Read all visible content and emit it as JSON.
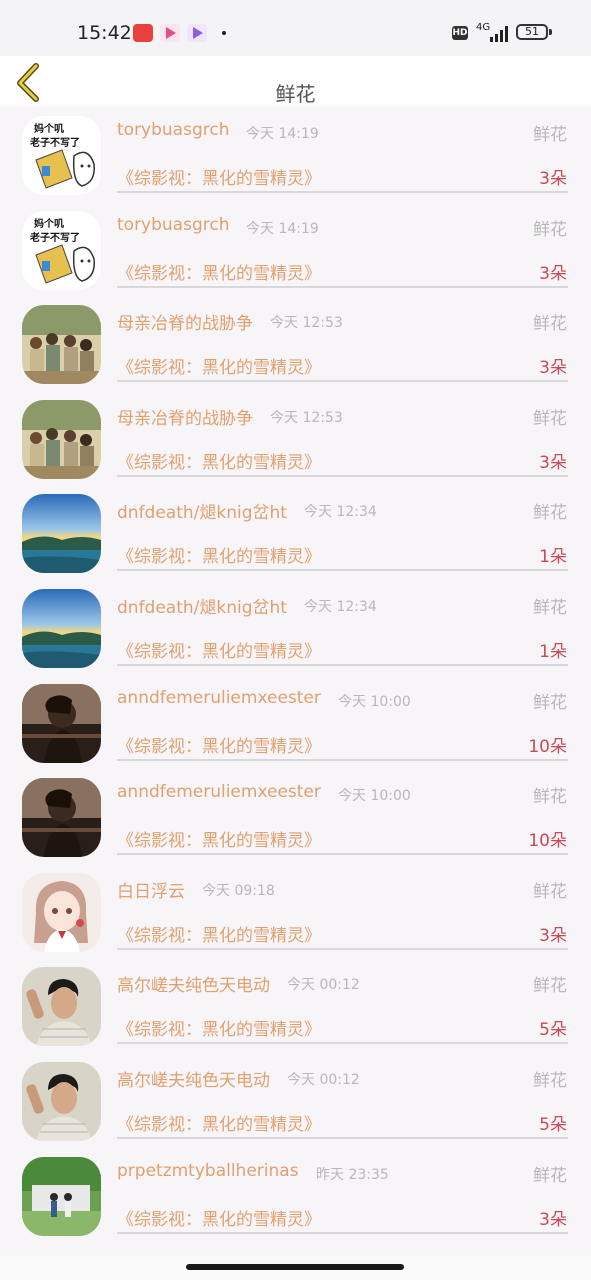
{
  "status_bar": {
    "time": "15:42",
    "network": "4G",
    "battery": "51"
  },
  "header": {
    "title": "鲜花"
  },
  "items": [
    {
      "name": "torybuasgrch",
      "time": "今天 14:19",
      "kind": "鲜花",
      "book": "《综影视：黑化的雪精灵》",
      "count": "3朵",
      "avatar": "meme-avatar"
    },
    {
      "name": "torybuasgrch",
      "time": "今天 14:19",
      "kind": "鲜花",
      "book": "《综影视：黑化的雪精灵》",
      "count": "3朵",
      "avatar": "meme-avatar"
    },
    {
      "name": "母亲冶脊的战胁争",
      "time": "今天 12:53",
      "kind": "鲜花",
      "book": "《综影视：黑化的雪精灵》",
      "count": "3朵",
      "avatar": "group-photo-avatar"
    },
    {
      "name": "母亲冶脊的战胁争",
      "time": "今天 12:53",
      "kind": "鲜花",
      "book": "《综影视：黑化的雪精灵》",
      "count": "3朵",
      "avatar": "group-photo-avatar"
    },
    {
      "name": "dnfdeath/煺knig岔ht",
      "time": "今天 12:34",
      "kind": "鲜花",
      "book": "《综影视：黑化的雪精灵》",
      "count": "1朵",
      "avatar": "landscape-avatar"
    },
    {
      "name": "dnfdeath/煺knig岔ht",
      "time": "今天 12:34",
      "kind": "鲜花",
      "book": "《综影视：黑化的雪精灵》",
      "count": "1朵",
      "avatar": "landscape-avatar"
    },
    {
      "name": "anndfemeruliemxeester",
      "time": "今天 10:00",
      "kind": "鲜花",
      "book": "《综影视：黑化的雪精灵》",
      "count": "10朵",
      "avatar": "silhouette-avatar"
    },
    {
      "name": "anndfemeruliemxeester",
      "time": "今天 10:00",
      "kind": "鲜花",
      "book": "《综影视：黑化的雪精灵》",
      "count": "10朵",
      "avatar": "silhouette-avatar"
    },
    {
      "name": "白日浮云",
      "time": "今天 09:18",
      "kind": "鲜花",
      "book": "《综影视：黑化的雪精灵》",
      "count": "3朵",
      "avatar": "anime-girl-avatar"
    },
    {
      "name": "高尔嵯夫纯色天电动",
      "time": "今天 00:12",
      "kind": "鲜花",
      "book": "《综影视：黑化的雪精灵》",
      "count": "5朵",
      "avatar": "portrait-avatar"
    },
    {
      "name": "高尔嵯夫纯色天电动",
      "time": "今天 00:12",
      "kind": "鲜花",
      "book": "《综影视：黑化的雪精灵》",
      "count": "5朵",
      "avatar": "portrait-avatar"
    },
    {
      "name": "prpetzmtyballherinas",
      "time": "昨天 23:35",
      "kind": "鲜花",
      "book": "《综影视：黑化的雪精灵》",
      "count": "3朵",
      "avatar": "park-avatar"
    }
  ]
}
